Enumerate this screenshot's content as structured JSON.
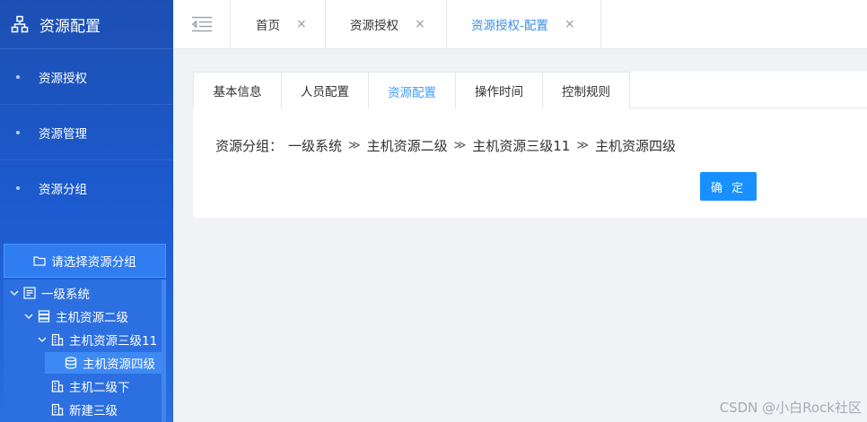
{
  "sidebar": {
    "title": "资源配置",
    "title_icon": "sitemap-icon",
    "menu": [
      {
        "label": "资源授权"
      },
      {
        "label": "资源管理"
      },
      {
        "label": "资源分组"
      }
    ],
    "group_button": "请选择资源分组",
    "tree": [
      {
        "label": "一级系统",
        "icon": "server-rack-icon",
        "expanded": true
      },
      {
        "label": "主机资源二级",
        "icon": "server-icon",
        "expanded": true
      },
      {
        "label": "主机资源三级11",
        "icon": "building-icon",
        "expanded": true
      },
      {
        "label": "主机资源四级",
        "icon": "database-icon",
        "selected": true
      },
      {
        "label": "主机二级下",
        "icon": "building-icon"
      },
      {
        "label": "新建三级",
        "icon": "building-icon"
      }
    ]
  },
  "topbar": {
    "tabs": [
      {
        "label": "首页",
        "close": "×"
      },
      {
        "label": "资源授权",
        "close": "×"
      },
      {
        "label": "资源授权-配置",
        "close": "×",
        "active": true
      }
    ]
  },
  "content": {
    "tabs": [
      "基本信息",
      "人员配置",
      "资源配置",
      "操作时间",
      "控制规则"
    ],
    "active_tab": "资源配置",
    "breadcrumb_label": "资源分组：",
    "breadcrumb": [
      "一级系统",
      "主机资源二级",
      "主机资源三级11",
      "主机资源四级"
    ],
    "breadcrumb_sep": "≫",
    "confirm_button": "确 定"
  },
  "watermark": "CSDN @小白Rock社区",
  "colors": {
    "sidebar_top": "#1d4fb3",
    "sidebar_bottom": "#2a6ee0",
    "accent": "#409eff",
    "button": "#1890ff"
  }
}
